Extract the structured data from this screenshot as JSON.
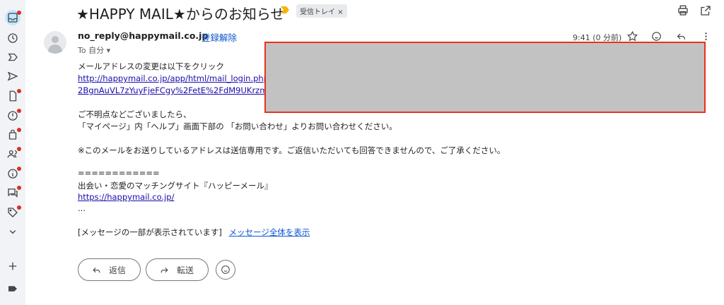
{
  "message": {
    "subject": "★HAPPY MAIL★からのお知らせ",
    "label_chip": "受信トレイ",
    "label_chip_close": "×",
    "sender": "no_reply@happymail.co.jp",
    "unsubscribe": "登録解除",
    "to": "To 自分",
    "time": "9:41 (0 分前)",
    "body": {
      "line1": "メールアドレスの変更は以下をクリック",
      "link1a": "http://happymail.co.jp/app/html/mail_login.php?aid=05",
      "link1b": "2BgnAuVL7zYuyFjeFCgy%2FetE%2FdM9UKrzmnS8",
      "line2": "ご不明点などございましたら、",
      "line3": "「マイページ」内「ヘルプ」画面下部の 「お問い合わせ」よりお問い合わせください。",
      "line4": "※このメールをお送りしているアドレスは送信専用です。ご返信いただいても回答できませんので、ご了承ください。",
      "line5": "============",
      "line6": "出会い・恋愛のマッチングサイト『ハッピーメール』",
      "link2": "https://happymail.co.jp/",
      "line7": "...",
      "clipped_text": "[メッセージの一部が表示されています]",
      "view_full": "メッセージ全体を表示"
    },
    "reply_label": "返信",
    "forward_label": "転送"
  },
  "icons": {
    "rail": [
      "inbox-icon",
      "clock-icon",
      "label-important-icon",
      "send-icon",
      "draft-icon",
      "spam-icon",
      "shopping-bag-icon",
      "contacts-icon",
      "info-icon",
      "forum-icon",
      "tag-icon",
      "chevron-down-icon",
      "plus-icon",
      "label-icon"
    ],
    "top": [
      "print-icon",
      "open-in-new-icon"
    ],
    "header": [
      "star-icon",
      "emoji-icon",
      "reply-icon",
      "more-icon"
    ]
  },
  "colors": {
    "accent": "#0b57d0",
    "link": "#1a0dab",
    "badge": "#d93025",
    "redaction_border": "#e8321b",
    "redaction_fill": "#c2c2c2"
  }
}
